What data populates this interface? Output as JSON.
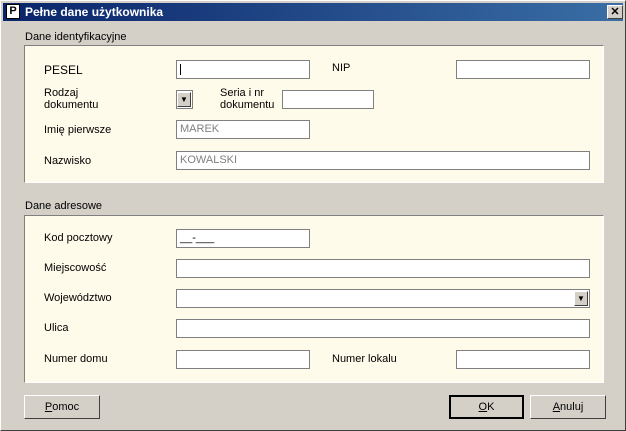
{
  "window": {
    "title": "Pełne dane użytkownika",
    "icon_letter": "P",
    "close_symbol": "✕"
  },
  "identification": {
    "section_title": "Dane identyfikacyjne",
    "pesel_label": "PESEL",
    "pesel_value": "",
    "nip_label": "NIP",
    "nip_value": "",
    "doc_type_label_line1": "Rodzaj",
    "doc_type_label_line2": "dokumentu",
    "doc_type_value": "",
    "doc_number_label_line1": "Seria i nr",
    "doc_number_label_line2": "dokumentu",
    "doc_number_value": "",
    "first_name_label": "Imię pierwsze",
    "first_name_value": "MAREK",
    "last_name_label": "Nazwisko",
    "last_name_value": "KOWALSKI"
  },
  "address": {
    "section_title": "Dane adresowe",
    "postal_code_label": "Kod pocztowy",
    "postal_code_value": "__-___",
    "city_label": "Miejscowość",
    "city_value": "",
    "voivodeship_label": "Województwo",
    "voivodeship_value": "",
    "street_label": "Ulica",
    "street_value": "",
    "house_number_label": "Numer domu",
    "house_number_value": "",
    "apartment_number_label": "Numer lokalu",
    "apartment_number_value": ""
  },
  "buttons": {
    "help_label_mnemonic": "P",
    "help_label_rest": "omoc",
    "ok_label_mnemonic": "O",
    "ok_label_rest": "K",
    "cancel_label_mnemonic": "A",
    "cancel_label_rest": "nuluj"
  },
  "icons": {
    "dropdown": "chevron-down-icon",
    "close": "close-icon",
    "app": "app-icon"
  }
}
